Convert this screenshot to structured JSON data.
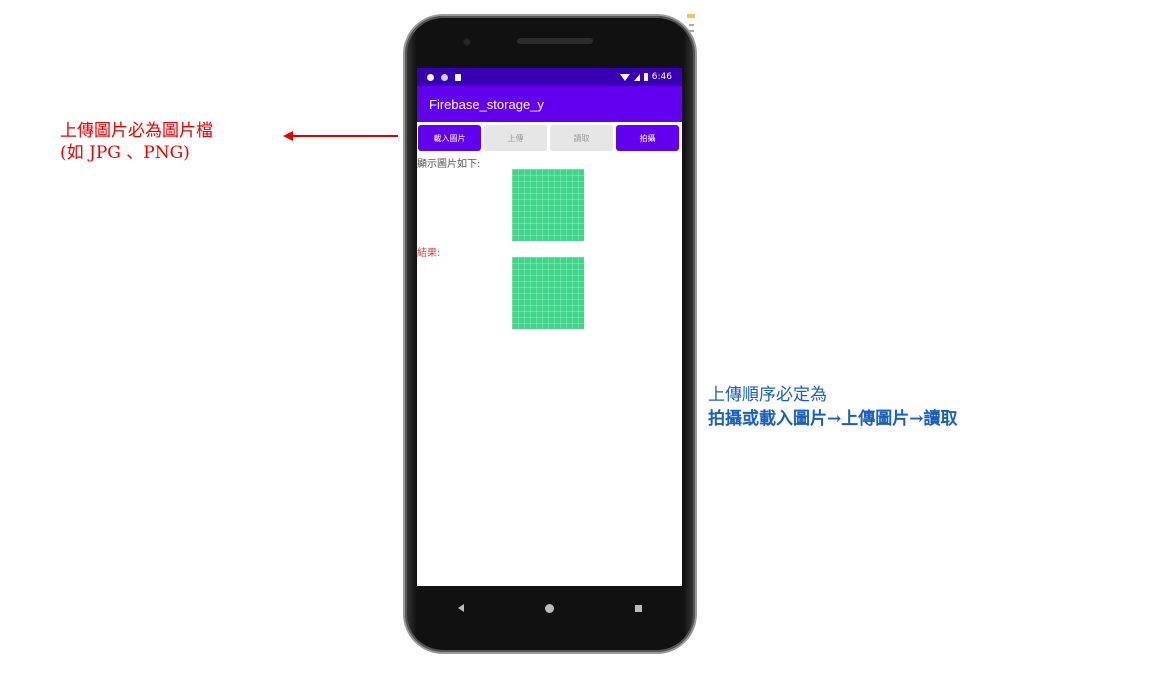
{
  "annotations": {
    "left_line1": "上傳圖片必為圖片檔",
    "left_line2": "(如 JPG 、PNG)",
    "right_line1": "上傳順序必定為",
    "right_seq": {
      "a": "拍攝或載入圖片",
      "arrow": "→",
      "b": "上傳圖片",
      "c": "讀取"
    },
    "colors": {
      "left": "#e60000",
      "right": "#1a5fbf"
    }
  },
  "status_bar": {
    "time": "6:46"
  },
  "app": {
    "title": "Firebase_storage_y",
    "buttons": [
      {
        "label": "載入圖片",
        "enabled": true
      },
      {
        "label": "上傳",
        "enabled": false
      },
      {
        "label": "讀取",
        "enabled": false
      },
      {
        "label": "拍攝",
        "enabled": true
      }
    ],
    "display_label": "顯示圖片如下:",
    "result_label": "結果:"
  },
  "nav": {
    "icons": [
      "back-icon",
      "home-icon",
      "recents-icon"
    ]
  },
  "theme": {
    "primary": "#6200ee",
    "primary_dark": "#3700b3",
    "image_green": "#3fd68a"
  }
}
